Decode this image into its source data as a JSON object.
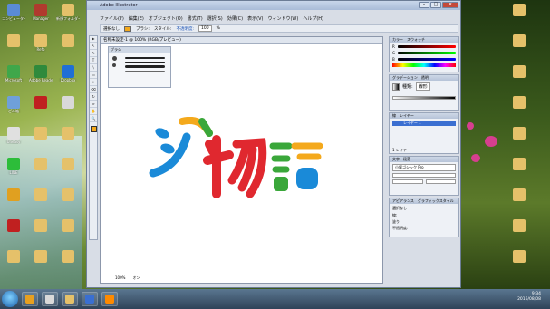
{
  "desktop": {
    "icons_left": [
      {
        "label": "コンピューター",
        "color": "#5a8bd6"
      },
      {
        "label": "Manager",
        "color": "#b03a2e"
      },
      {
        "label": "新規フォルダー",
        "color": "#e5c16a"
      },
      {
        "label": "",
        "color": "#e5c16a"
      },
      {
        "label": "Refo",
        "color": "#e5c16a"
      },
      {
        "label": "",
        "color": "#e5c16a"
      },
      {
        "label": "Microsoft",
        "color": "#3fa74a"
      },
      {
        "label": "Adobe Reader",
        "color": "#2f8a3c"
      },
      {
        "label": "Dropbox",
        "color": "#1f6fd6"
      },
      {
        "label": "ごみ箱",
        "color": "#6fa0d9"
      },
      {
        "label": "",
        "color": "#c02020"
      },
      {
        "label": "",
        "color": "#d9d9d9"
      },
      {
        "label": "Uneasy",
        "color": "#e0e0e0"
      },
      {
        "label": "",
        "color": "#e5c16a"
      },
      {
        "label": "",
        "color": "#e5c16a"
      },
      {
        "label": "LINE",
        "color": "#2dbd3a"
      },
      {
        "label": "",
        "color": "#e5c16a"
      },
      {
        "label": "",
        "color": "#e5c16a"
      },
      {
        "label": "",
        "color": "#e0a020"
      },
      {
        "label": "",
        "color": "#e5c16a"
      },
      {
        "label": "",
        "color": "#e5c16a"
      },
      {
        "label": "",
        "color": "#c02020"
      },
      {
        "label": "",
        "color": "#e5c16a"
      },
      {
        "label": "",
        "color": "#e5c16a"
      },
      {
        "label": "",
        "color": "#e5c16a"
      },
      {
        "label": "",
        "color": "#e5c16a"
      },
      {
        "label": "",
        "color": "#e5c16a"
      }
    ],
    "icons_right": [
      {
        "label": "",
        "color": "#e5c16a"
      },
      {
        "label": "",
        "color": "#e5c16a"
      },
      {
        "label": "",
        "color": "#e5c16a"
      },
      {
        "label": "",
        "color": "#e5c16a"
      },
      {
        "label": "",
        "color": "#e5c16a"
      },
      {
        "label": "",
        "color": "#e5c16a"
      },
      {
        "label": "",
        "color": "#e5c16a"
      },
      {
        "label": "",
        "color": "#e5c16a"
      },
      {
        "label": "",
        "color": "#e5c16a"
      }
    ]
  },
  "app": {
    "title": "Adobe Illustrator",
    "menu": [
      "ファイル(F)",
      "編集(E)",
      "オブジェクト(O)",
      "書式(T)",
      "選択(S)",
      "効果(C)",
      "表示(V)",
      "ウィンドウ(W)",
      "ヘルプ(H)"
    ],
    "options": [
      "選択なし",
      "ブラシ:",
      "スタイル:",
      "不透明度:",
      "100",
      "%"
    ],
    "tools": [
      "▶",
      "↖",
      "✎",
      "T",
      "\\",
      "▭",
      "✏",
      "⌫",
      "↻",
      "⇔",
      "✋",
      "🔍"
    ],
    "doc_tab": "名称未設定-1 @ 100% (RGB/プレビュー)",
    "brush_panel_title": "ブラシ",
    "status": [
      "100%",
      "オン"
    ]
  },
  "logo": {
    "glyphs": [
      {
        "char": "ン",
        "color": "#1a8ad8"
      },
      {
        "char": "物",
        "color": "#e0282f"
      },
      {
        "char": "語",
        "color": "#f4a91c"
      }
    ],
    "accent_colors": [
      "#1a8ad8",
      "#3aa73a",
      "#f4a91c",
      "#e0282f"
    ]
  },
  "panels": {
    "color": {
      "tabs": [
        "カラー",
        "スウォッチ"
      ],
      "channels": [
        "R",
        "G",
        "B"
      ]
    },
    "gradient": {
      "tabs": [
        "グラデーション",
        "透明"
      ],
      "type_label": "種類:",
      "type_value": "線形"
    },
    "stroke": {
      "tabs": [
        "線",
        "透明"
      ],
      "weight_label": "線幅:"
    },
    "layers": {
      "tabs": [
        "レイヤー"
      ],
      "layer_name": "レイヤー 1",
      "footer": "1 レイヤー"
    },
    "char": {
      "tabs": [
        "文字",
        "段落"
      ],
      "font": "小塚ゴシック Pro"
    },
    "appearance": {
      "tabs": [
        "アピアランス",
        "グラフィックスタイル"
      ],
      "items": [
        "選択なし",
        "線:",
        "塗り:",
        "不透明度:"
      ]
    }
  },
  "taskbar": {
    "items": [
      {
        "color": "#e8a020"
      },
      {
        "color": "#d9d9d9"
      },
      {
        "color": "#e5c16a"
      },
      {
        "color": "#3a6fd1"
      },
      {
        "color": "#ff8a00"
      }
    ],
    "time": "9:34",
    "date": "2016/08/08"
  }
}
